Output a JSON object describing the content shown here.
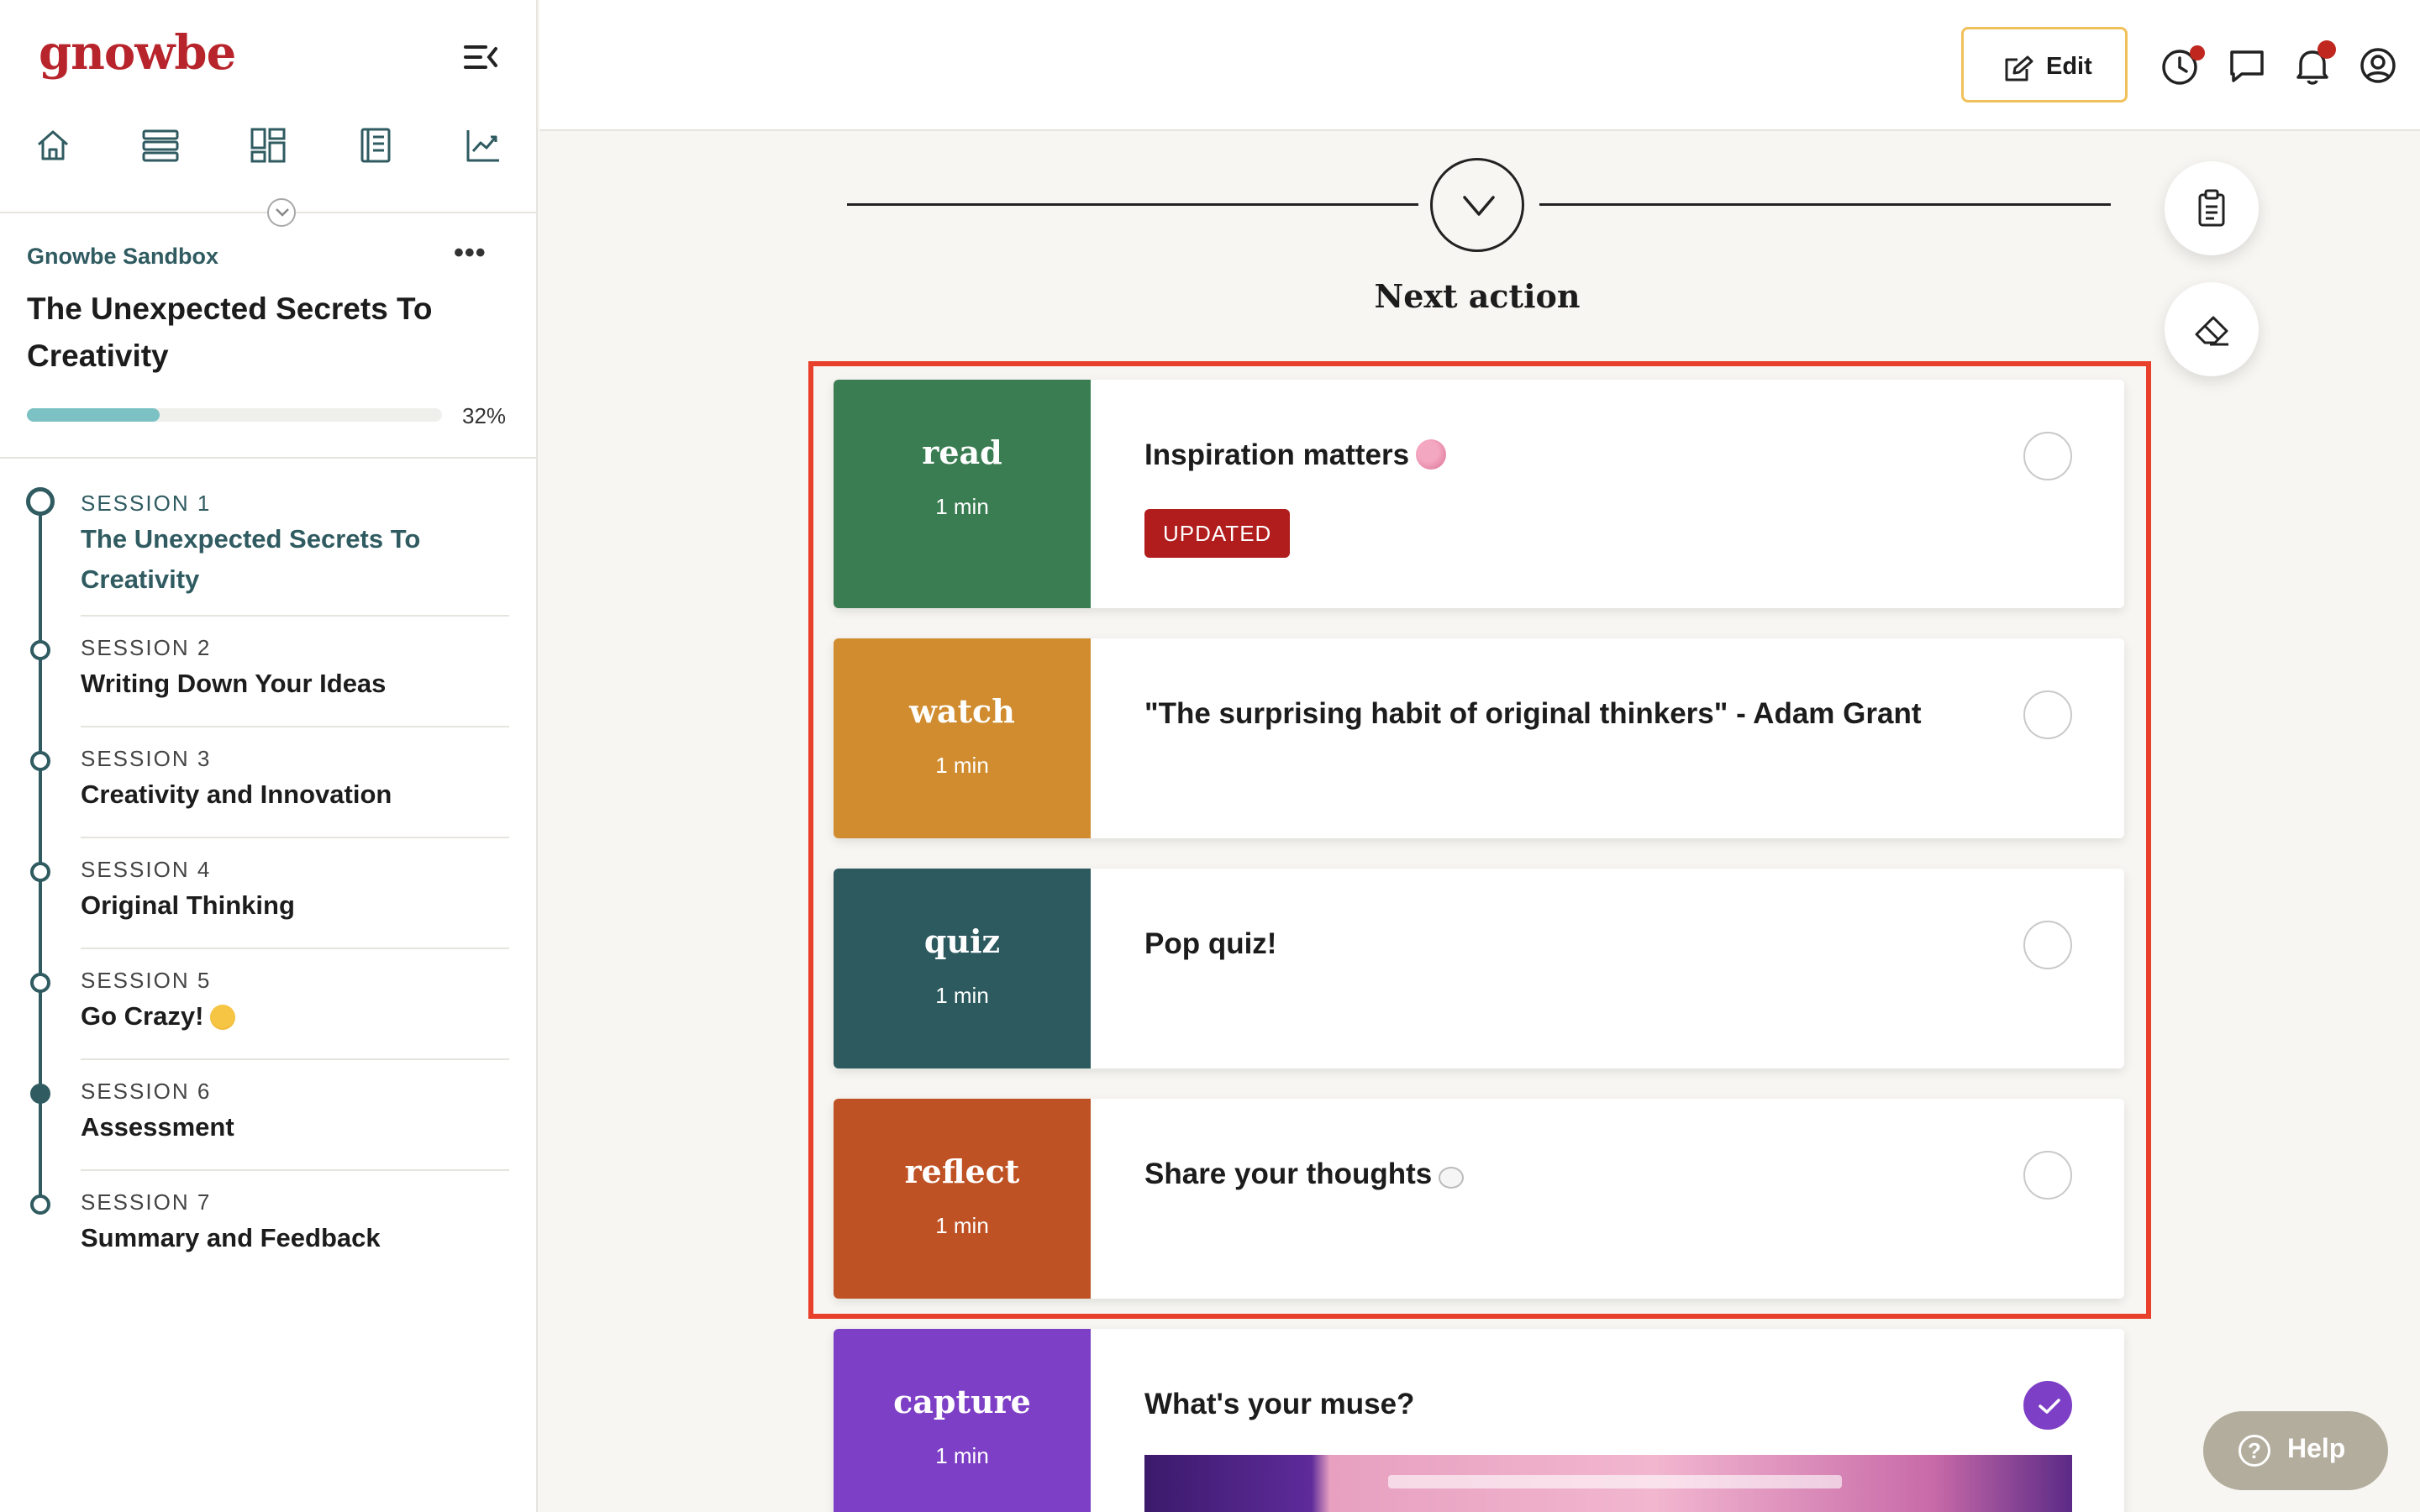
{
  "sidebar": {
    "logo": "gnowbe",
    "workspace": "Gnowbe Sandbox",
    "more": "•••",
    "course_title": "The Unexpected Secrets To Creativity",
    "progress_pct": 32,
    "progress_label": "32%",
    "sessions": [
      {
        "num": "SESSION 1",
        "name": "The Unexpected Secrets To Creativity"
      },
      {
        "num": "SESSION 2",
        "name": "Writing Down Your Ideas"
      },
      {
        "num": "SESSION 3",
        "name": "Creativity and Innovation"
      },
      {
        "num": "SESSION 4",
        "name": "Original Thinking"
      },
      {
        "num": "SESSION 5",
        "name": "Go Crazy!"
      },
      {
        "num": "SESSION 6",
        "name": "Assessment"
      },
      {
        "num": "SESSION 7",
        "name": "Summary and Feedback"
      }
    ]
  },
  "header": {
    "edit_label": "Edit"
  },
  "main": {
    "next_action_label": "Next action",
    "cards": [
      {
        "kind": "read",
        "duration": "1 min",
        "title": "Inspiration matters",
        "badge": "UPDATED",
        "color": "#3a7d52"
      },
      {
        "kind": "watch",
        "duration": "1 min",
        "title": "\"The surprising habit of original thinkers\" - Adam Grant",
        "color": "#d08c2f"
      },
      {
        "kind": "quiz",
        "duration": "1 min",
        "title": "Pop quiz!",
        "color": "#2c5a5e"
      },
      {
        "kind": "reflect",
        "duration": "1 min",
        "title": "Share your thoughts",
        "color": "#bf5224"
      },
      {
        "kind": "capture",
        "duration": "1 min",
        "title": "What's your muse?",
        "color": "#7d3fc5"
      }
    ]
  },
  "help": {
    "icon": "?",
    "label": "Help"
  },
  "colors": {
    "brand": "#b8242b",
    "teal": "#2f5b61",
    "highlight": "#e8402a"
  }
}
